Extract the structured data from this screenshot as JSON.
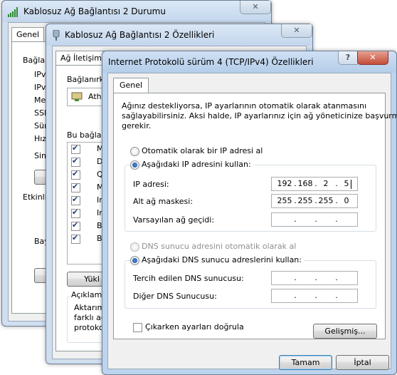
{
  "status_window": {
    "title": "Kablosuz Ağ Bağlantısı 2 Durumu",
    "tab": "Genel",
    "section_fragment": "Bağlan",
    "rows": [
      "IPv",
      "IPv",
      "Med",
      "SSII",
      "Süre",
      "Hız:"
    ],
    "signal_fragment": "Sinya",
    "button_fragment": "A",
    "activity_fragment": "Etkinlik",
    "bytes_fragment": "Bay"
  },
  "props_window": {
    "title": "Kablosuz Ağ Bağlantısı 2 Özellikleri",
    "tab": "Ağ İletişimi",
    "connect_using_fragment": "Bağlanırken",
    "adapter_fragment": "Athe",
    "items_fragment": "Bu bağlant",
    "items": [
      "M",
      "D",
      "Q",
      "M",
      "In",
      "In",
      "Ba",
      "Ba"
    ],
    "install_fragment": "Yükl",
    "description_label": "Açıklama",
    "description_fragment": [
      "Aktarım",
      "farklı ağl",
      "protokol"
    ]
  },
  "ipv4_dialog": {
    "title": "Internet Protokolü sürüm 4 (TCP/IPv4) Özellikleri",
    "help": "?",
    "close": "X",
    "tab": "Genel",
    "description": [
      "Ağınız destekliyorsa, IP ayarlarının otomatik olarak atanmasını",
      "sağlayabilirsiniz. Aksi halde, IP ayarlarınız için ağ yöneticinize başvurmanız",
      "gerekir."
    ],
    "auto_ip_label": "Otomatik olarak bir IP adresi al",
    "manual_ip_label": "Aşağıdaki IP adresini kullan:",
    "ip_address_label": "IP adresi:",
    "ip_address": [
      "192",
      "168",
      "2",
      "5"
    ],
    "subnet_label": "Alt ağ maskesi:",
    "subnet": [
      "255",
      "255",
      "255",
      "0"
    ],
    "gateway_label": "Varsayılan ağ geçidi:",
    "gateway": [
      "",
      "",
      "",
      ""
    ],
    "auto_dns_label": "DNS sunucu adresini otomatik olarak al",
    "manual_dns_label": "Aşağıdaki DNS sunucu adreslerini kullan:",
    "preferred_dns_label": "Tercih edilen DNS sunucusu:",
    "preferred_dns": [
      "",
      "",
      "",
      ""
    ],
    "alternate_dns_label": "Diğer DNS Sunucusu:",
    "alternate_dns": [
      "",
      "",
      "",
      ""
    ],
    "validate_label": "Çıkarken ayarları doğrula",
    "advanced_button": "Gelişmiş...",
    "ok_button": "Tamam",
    "cancel_button": "İptal"
  },
  "colors": {
    "accent": "#3c7fb1",
    "title_gradient_top": "#dbe8f6",
    "close_red": "#c44d3a"
  },
  "icons": [
    "signal-bars-icon",
    "network-adapter-icon",
    "help-icon",
    "close-icon"
  ]
}
